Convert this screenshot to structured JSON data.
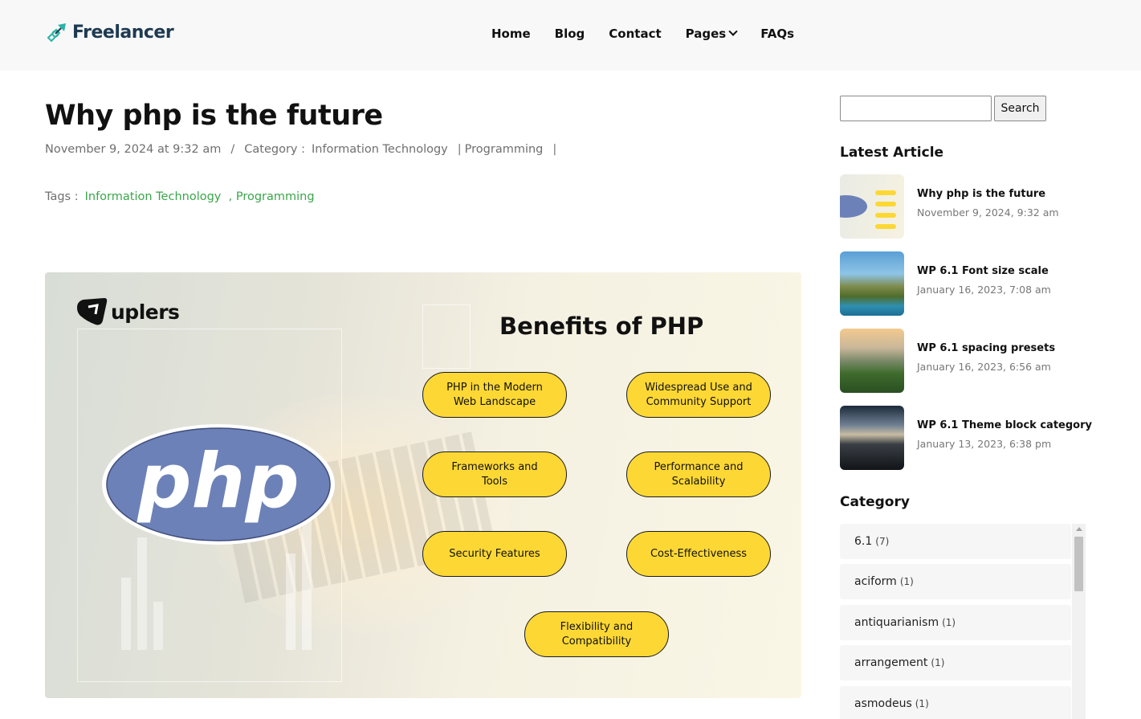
{
  "header": {
    "logo_text": "Freelancer",
    "nav": [
      {
        "label": "Home"
      },
      {
        "label": "Blog"
      },
      {
        "label": "Contact"
      },
      {
        "label": "Pages",
        "has_dropdown": true
      },
      {
        "label": "FAQs"
      }
    ]
  },
  "article": {
    "title": "Why php is the future",
    "date": "November 9, 2024 at 9:32 am",
    "date_sep": "/",
    "category_label": "Category :",
    "categories": [
      "Information Technology",
      "Programming"
    ],
    "tags_label": "Tags :",
    "tags": [
      "Information Technology",
      ", Programming"
    ],
    "hero": {
      "brand": "uplers",
      "heading": "Benefits of PHP",
      "php_text": "php",
      "benefits": [
        "PHP in the Modern\nWeb Landscape",
        "Widespread Use and\nCommunity Support",
        "Frameworks and\nTools",
        "Performance and\nScalability",
        "Security Features",
        "Cost-Effectiveness",
        "Flexibility and\nCompatibility"
      ]
    }
  },
  "sidebar": {
    "search": {
      "placeholder": "",
      "button_label": "Search"
    },
    "latest_heading": "Latest Article",
    "latest": [
      {
        "title": "Why php is the future",
        "date": "November 9, 2024, 9:32 am"
      },
      {
        "title": "WP 6.1 Font size scale",
        "date": "January 16, 2023, 7:08 am"
      },
      {
        "title": "WP 6.1 spacing presets",
        "date": "January 16, 2023, 6:56 am"
      },
      {
        "title": "WP 6.1 Theme block category",
        "date": "January 13, 2023, 6:38 pm"
      }
    ],
    "category_heading": "Category",
    "categories": [
      {
        "name": "6.1",
        "count": "(7)"
      },
      {
        "name": "aciform",
        "count": "(1)"
      },
      {
        "name": "antiquarianism",
        "count": "(1)"
      },
      {
        "name": "arrangement",
        "count": "(1)"
      },
      {
        "name": "asmodeus",
        "count": "(1)"
      }
    ]
  },
  "colors": {
    "accent_green": "#3aa64a",
    "pill_yellow": "#fdd835",
    "php_blue": "#6c81b8",
    "logo_teal": "#2bb3a6"
  }
}
